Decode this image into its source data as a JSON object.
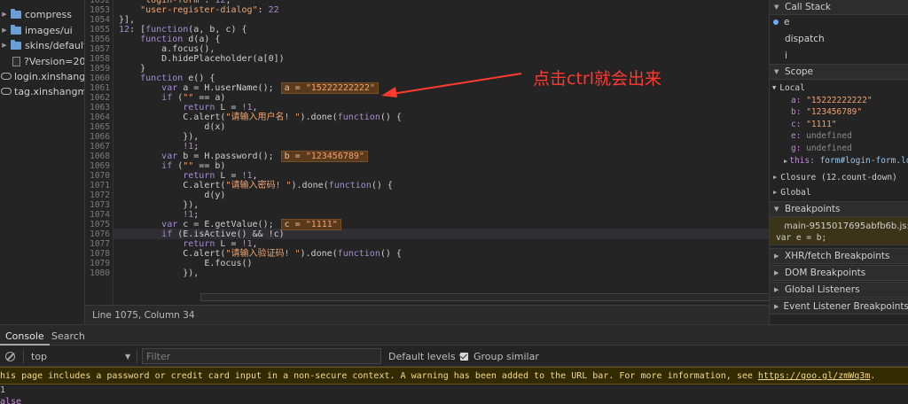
{
  "filetree": {
    "items": [
      {
        "label": "compress"
      },
      {
        "label": "images/ui"
      },
      {
        "label": "skins/default"
      },
      {
        "label": "?Version=202"
      },
      {
        "label": "login.xinshangmeng"
      },
      {
        "label": "tag.xinshangmeng"
      }
    ]
  },
  "editor": {
    "lines": [
      {
        "n": "1052",
        "t": "    \"login-form\": 12,"
      },
      {
        "n": "1053",
        "t": "    \"user-register-dialog\": 22"
      },
      {
        "n": "1054",
        "t": "}],"
      },
      {
        "n": "1055",
        "t": "12: [function(a, b, c) {"
      },
      {
        "n": "1056",
        "t": "    function d(a) {"
      },
      {
        "n": "1057",
        "t": "        a.focus(),"
      },
      {
        "n": "1058",
        "t": "        D.hidePlaceholder(a[0])"
      },
      {
        "n": "1059",
        "t": "    }"
      },
      {
        "n": "1060",
        "t": "    function e() {"
      },
      {
        "n": "1061",
        "t": "        var a = H.userName();"
      },
      {
        "n": "1062",
        "t": "        if (\"\" == a)"
      },
      {
        "n": "1063",
        "t": "            return L = !1,"
      },
      {
        "n": "1064",
        "t": "            C.alert(\"请输入用户名! \").done(function() {"
      },
      {
        "n": "1065",
        "t": "                d(x)"
      },
      {
        "n": "1066",
        "t": "            }),"
      },
      {
        "n": "1067",
        "t": "            !1;"
      },
      {
        "n": "1068",
        "t": "        var b = H.password();"
      },
      {
        "n": "1069",
        "t": "        if (\"\" == b)"
      },
      {
        "n": "1070",
        "t": "            return L = !1,"
      },
      {
        "n": "1071",
        "t": "            C.alert(\"请输入密码! \").done(function() {"
      },
      {
        "n": "1072",
        "t": "                d(y)"
      },
      {
        "n": "1073",
        "t": "            }),"
      },
      {
        "n": "1074",
        "t": "            !1;"
      },
      {
        "n": "1075",
        "t": "        var c = E.getValue();"
      },
      {
        "n": "1076",
        "t": "        if (E.isActive() && !c)"
      },
      {
        "n": "1077",
        "t": "            return L = !1,"
      },
      {
        "n": "1078",
        "t": "            C.alert(\"请输入验证码! \").done(function() {"
      },
      {
        "n": "1079",
        "t": "                E.focus()"
      },
      {
        "n": "1080",
        "t": "            }),"
      }
    ],
    "inline_values": [
      {
        "line": "1061",
        "label": "a = \"15222222222\""
      },
      {
        "line": "1068",
        "label": "b = \"123456789\""
      },
      {
        "line": "1075",
        "label": "c = \"1111\""
      }
    ],
    "status": "Line 1075, Column 34",
    "annotation": "点击ctrl就会出来"
  },
  "debugger": {
    "call_stack_title": "Call Stack",
    "call_stack": [
      "e",
      "dispatch",
      "i"
    ],
    "scope_title": "Scope",
    "local_title": "Local",
    "local_vars": [
      {
        "key": "a",
        "value": "\"15222222222\""
      },
      {
        "key": "b",
        "value": "\"123456789\""
      },
      {
        "key": "c",
        "value": "\"1111\""
      },
      {
        "key": "e",
        "value": "undefined"
      },
      {
        "key": "g",
        "value": "undefined"
      },
      {
        "key": "this",
        "value": "form#login-form.lo"
      }
    ],
    "closure_label": "Closure (12.count-down)",
    "global_label": "Global",
    "breakpoints_title": "Breakpoints",
    "breakpoint_file": "main-9515017695abfb6b.js:",
    "breakpoint_code": "var e = b;",
    "sections": [
      "XHR/fetch Breakpoints",
      "DOM Breakpoints",
      "Global Listeners",
      "Event Listener Breakpoints"
    ]
  },
  "drawer": {
    "tabs": [
      "Console",
      "Search"
    ],
    "context": "top",
    "filter_placeholder": "Filter",
    "levels": "Default levels",
    "group_similar": "Group similar",
    "warning_text": "his page includes a password or credit card input in a non-secure context. A warning has been added to the URL bar. For more information, see ",
    "warning_link": "https://goo.gl/zmWq3m",
    "warning_end": ".",
    "output_lines": [
      "1",
      "alse"
    ]
  },
  "colors": {
    "annotation": "#ff3a2f",
    "inline_value_bg": "#5a3a1c",
    "warning_bg": "#332b00"
  }
}
